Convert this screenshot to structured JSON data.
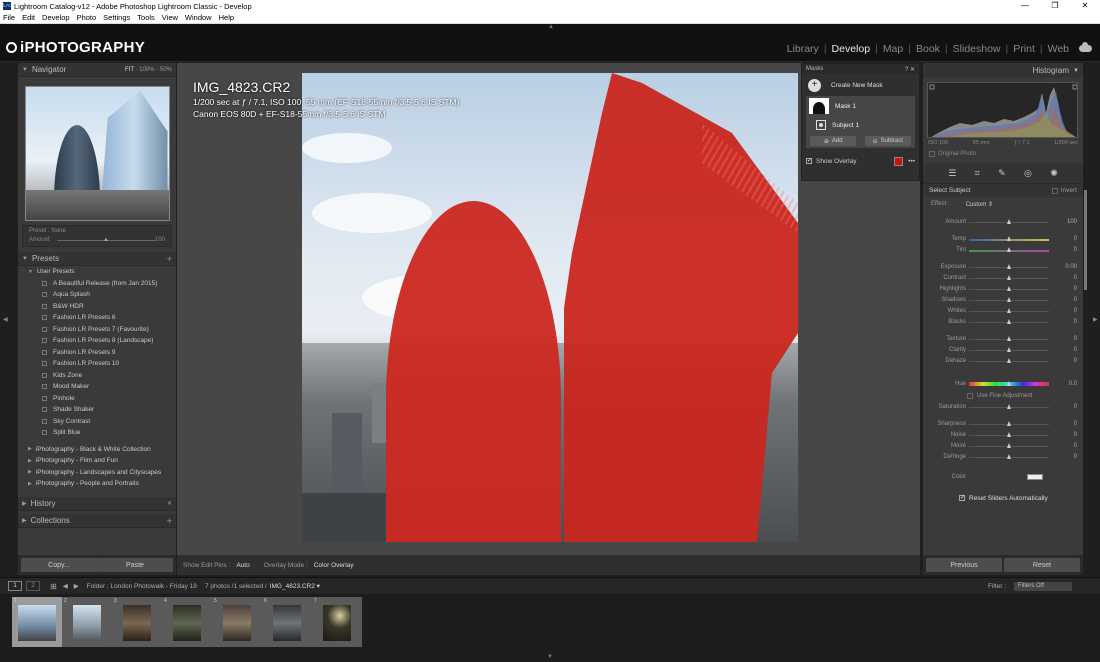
{
  "window": {
    "title": "Lightroom Catalog-v12 - Adobe Photoshop Lightroom Classic - Develop",
    "app_icon": "Lrc",
    "controls": {
      "minimize": "—",
      "maximize": "❐",
      "close": "✕"
    }
  },
  "menu": [
    "File",
    "Edit",
    "Develop",
    "Photo",
    "Settings",
    "Tools",
    "View",
    "Window",
    "Help"
  ],
  "identity": {
    "logo": "iPHOTOGRAPHY"
  },
  "modules": {
    "items": [
      "Library",
      "Develop",
      "Map",
      "Book",
      "Slideshow",
      "Print",
      "Web"
    ],
    "active": "Develop"
  },
  "navigator": {
    "title": "Navigator",
    "zoom_options": [
      "FIT",
      "100%",
      "50%"
    ]
  },
  "preset_box": {
    "preset_label": "Preset :",
    "preset_value": "None",
    "amount_label": "Amount",
    "amount_value": "100"
  },
  "presets": {
    "title": "Presets",
    "add_icon": "+",
    "user_group": "User Presets",
    "user_items": [
      "A Beautiful Release (from Jan 2015)",
      "Aqua Splash",
      "B&W HDR",
      "Fashion LR Presets 6",
      "Fashion LR Presets 7 (Favourite)",
      "Fashion LR Presets 8 (Landscape)",
      "Fashion LR Presets 9",
      "Fashion LR Presets 10",
      "Kids Zone",
      "Mood Maker",
      "Pinhole",
      "Shade Shaker",
      "Sky Contrast",
      "Split Blue"
    ],
    "other_groups": [
      "iPhotography - Black & White Collection",
      "iPhotography - Film and Fun",
      "iPhotography - Landscapes and Cityscapes",
      "iPhotography - People and Portraits"
    ]
  },
  "history": {
    "title": "History",
    "close_icon": "✕"
  },
  "collections": {
    "title": "Collections",
    "add_icon": "+"
  },
  "left_buttons": {
    "copy": "Copy...",
    "paste": "Paste"
  },
  "photo_info": {
    "filename": "IMG_4823.CR2",
    "line1": "1/200 sec at ƒ / 7.1, ISO 100, 55 mm (EF-S18-55mm f/3.5-5.6 IS STM)",
    "line2": "Canon EOS 80D + EF-S18-55mm f/3.5-5.6 IS STM"
  },
  "masks": {
    "title": "Masks",
    "create_label": "Create New Mask",
    "mask_name": "Mask 1",
    "subject_name": "Subject 1",
    "add_label": "Add",
    "subtract_label": "Subtract",
    "show_overlay_label": "Show Overlay",
    "overlay_color": "#cc1111"
  },
  "toolbar": {
    "edit_pins_label": "Show Edit Pins :",
    "edit_pins_value": "Auto",
    "overlay_mode_label": "Overlay Mode :",
    "overlay_mode_value": "Color Overlay"
  },
  "histogram": {
    "title": "Histogram",
    "iso": "ISO 100",
    "focal": "55 mm",
    "aperture": "ƒ / 7.1",
    "shutter": "1/200 sec",
    "original_photo_label": "Original Photo"
  },
  "mask_adjust": {
    "select_subject_label": "Select Subject",
    "invert_label": "Invert",
    "effect_label": "Effect :",
    "effect_value": "Custom",
    "amount": {
      "label": "Amount",
      "value": "100"
    },
    "groups": [
      [
        {
          "label": "Temp",
          "value": "0"
        },
        {
          "label": "Tint",
          "value": "0"
        }
      ],
      [
        {
          "label": "Exposure",
          "value": "0.00"
        },
        {
          "label": "Contrast",
          "value": "0"
        },
        {
          "label": "Highlights",
          "value": "0"
        },
        {
          "label": "Shadows",
          "value": "0"
        },
        {
          "label": "Whites",
          "value": "0"
        },
        {
          "label": "Blacks",
          "value": "0"
        }
      ],
      [
        {
          "label": "Texture",
          "value": "0"
        },
        {
          "label": "Clarity",
          "value": "0"
        },
        {
          "label": "Dehaze",
          "value": "0"
        }
      ]
    ],
    "hue": {
      "label": "Hue",
      "value": "0.0"
    },
    "fine_adjust_label": "Use Fine Adjustment",
    "saturation": {
      "label": "Saturation",
      "value": "0"
    },
    "detail_group": [
      {
        "label": "Sharpness",
        "value": "0"
      },
      {
        "label": "Noise",
        "value": "0"
      },
      {
        "label": "Moiré",
        "value": "0"
      },
      {
        "label": "Defringe",
        "value": "0"
      }
    ],
    "color_label": "Color",
    "reset_label": "Reset Sliders Automatically"
  },
  "right_buttons": {
    "previous": "Previous",
    "reset": "Reset"
  },
  "filmbar": {
    "view1": "1",
    "view2": "2",
    "folder_label": "Folder : London Photowalk - Friday 18",
    "count_label": "7 photos /1 selected /",
    "current_file": "IMG_4823.CR2",
    "filter_label": "Filter :",
    "filter_value": "Filters Off"
  },
  "filmstrip": {
    "thumbs": [
      "1",
      "2",
      "3",
      "4",
      "5",
      "6",
      "7"
    ],
    "selected": 0
  }
}
